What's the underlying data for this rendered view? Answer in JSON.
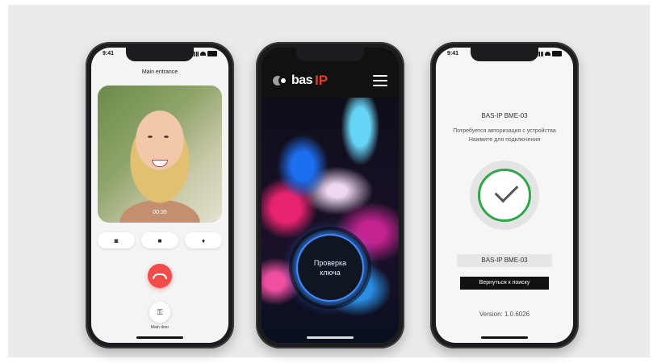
{
  "phone1": {
    "status_time": "9:41",
    "title": "Main entrance",
    "call_duration": "00:35",
    "controls": [
      {
        "icon": "camera-icon",
        "glyph": "◙"
      },
      {
        "icon": "video-icon",
        "glyph": "■"
      },
      {
        "icon": "microphone-icon",
        "glyph": "♦"
      }
    ],
    "end_call_icon": "end-call-icon",
    "unlock_icon": "lock-icon",
    "unlock_glyph": "⚿",
    "door_label": "Main door"
  },
  "phone2": {
    "logo_text": "bas",
    "logo_accent": "IP",
    "check_label": "Проверка ключа"
  },
  "phone3": {
    "status_time": "9:41",
    "device_name": "BAS-IP BME-03",
    "auth_text_line1": "Потребуется авторизация с устройства",
    "auth_text_line2": "Нажмите для подключения",
    "device_chip": "BAS-IP BME-03",
    "back_button": "Вернуться к поиску",
    "version": "Version: 1.0.6026"
  },
  "colors": {
    "accent_red": "#f34a4a",
    "success_green": "#2ea84a",
    "ring_blue": "#3f8cff"
  }
}
